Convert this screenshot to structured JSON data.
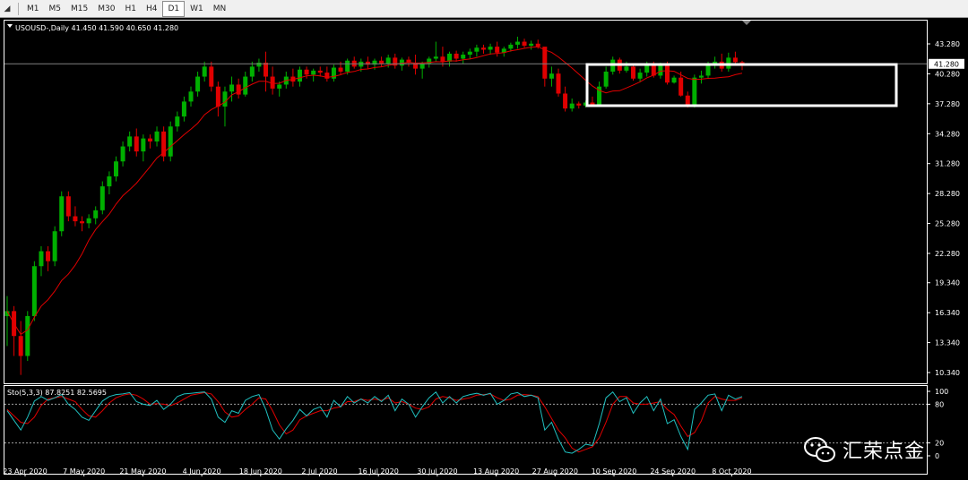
{
  "toolbar": {
    "timeframes": [
      "M1",
      "M5",
      "M15",
      "M30",
      "H1",
      "H4",
      "D1",
      "W1",
      "MN"
    ],
    "active": "D1"
  },
  "chart_data": {
    "type": "candlestick",
    "symbol_header": "USOUSD-,Daily  41.450 41.590 40.650 41.280",
    "price_axis": [
      "43.280",
      "40.280",
      "37.280",
      "34.280",
      "31.280",
      "28.280",
      "25.280",
      "22.280",
      "19.340",
      "16.340",
      "13.340",
      "10.340"
    ],
    "current_price_label": "41.280",
    "current_price": 41.28,
    "x_labels": [
      "23 Apr 2020",
      "7 May 2020",
      "21 May 2020",
      "4 Jun 2020",
      "18 Jun 2020",
      "2 Jul 2020",
      "16 Jul 2020",
      "30 Jul 2020",
      "13 Aug 2020",
      "27 Aug 2020",
      "10 Sep 2020",
      "24 Sep 2020",
      "8 Oct 2020"
    ],
    "bull_color": "#00b000",
    "bear_color": "#e00000",
    "ma_color": "#e00000",
    "candles": [
      [
        16.0,
        18.0,
        13.0,
        16.5
      ],
      [
        16.5,
        17.0,
        12.0,
        14.0
      ],
      [
        14.0,
        15.5,
        10.1,
        12.0
      ],
      [
        12.0,
        16.5,
        11.5,
        16.0
      ],
      [
        16.0,
        21.5,
        15.5,
        21.0
      ],
      [
        21.0,
        23.0,
        20.0,
        22.5
      ],
      [
        22.5,
        23.0,
        20.5,
        21.5
      ],
      [
        21.5,
        25.0,
        21.0,
        24.5
      ],
      [
        24.5,
        28.5,
        24.0,
        28.0
      ],
      [
        28.0,
        28.5,
        25.5,
        26.0
      ],
      [
        26.0,
        27.0,
        25.0,
        25.5
      ],
      [
        25.5,
        26.0,
        24.5,
        25.3
      ],
      [
        25.3,
        26.2,
        24.8,
        25.8
      ],
      [
        25.8,
        27.0,
        25.2,
        26.6
      ],
      [
        26.6,
        29.5,
        26.2,
        29.0
      ],
      [
        29.0,
        30.5,
        28.2,
        30.0
      ],
      [
        30.0,
        32.0,
        29.5,
        31.5
      ],
      [
        31.5,
        33.5,
        31.0,
        33.0
      ],
      [
        33.0,
        34.5,
        32.5,
        34.0
      ],
      [
        34.0,
        34.8,
        32.0,
        32.5
      ],
      [
        32.5,
        34.2,
        31.5,
        33.8
      ],
      [
        33.8,
        34.2,
        32.8,
        33.5
      ],
      [
        33.5,
        35.0,
        33.0,
        34.5
      ],
      [
        34.5,
        35.0,
        31.5,
        32.0
      ],
      [
        32.0,
        35.5,
        31.5,
        35.0
      ],
      [
        35.0,
        36.5,
        34.5,
        36.0
      ],
      [
        36.0,
        38.0,
        35.5,
        37.5
      ],
      [
        37.5,
        39.0,
        37.0,
        38.5
      ],
      [
        38.5,
        40.5,
        38.0,
        40.0
      ],
      [
        40.0,
        41.5,
        39.5,
        41.0
      ],
      [
        41.0,
        41.5,
        38.5,
        39.0
      ],
      [
        39.0,
        39.5,
        36.0,
        37.0
      ],
      [
        37.0,
        39.0,
        35.0,
        38.5
      ],
      [
        38.5,
        40.0,
        37.5,
        39.2
      ],
      [
        39.2,
        39.8,
        37.8,
        38.2
      ],
      [
        38.2,
        40.5,
        38.0,
        40.0
      ],
      [
        40.0,
        41.5,
        39.5,
        41.0
      ],
      [
        41.0,
        41.8,
        40.5,
        41.4
      ],
      [
        41.4,
        42.5,
        38.5,
        40.0
      ],
      [
        40.0,
        41.0,
        38.2,
        38.8
      ],
      [
        38.8,
        39.5,
        38.0,
        39.2
      ],
      [
        39.2,
        40.5,
        38.8,
        40.0
      ],
      [
        40.0,
        40.8,
        39.0,
        39.5
      ],
      [
        39.5,
        41.0,
        39.0,
        40.7
      ],
      [
        40.7,
        41.0,
        39.8,
        40.2
      ],
      [
        40.2,
        40.8,
        39.5,
        40.6
      ],
      [
        40.6,
        41.0,
        40.0,
        40.4
      ],
      [
        40.4,
        41.0,
        39.5,
        39.8
      ],
      [
        39.8,
        41.2,
        39.5,
        40.9
      ],
      [
        40.9,
        41.5,
        40.2,
        40.5
      ],
      [
        40.5,
        41.8,
        40.2,
        41.6
      ],
      [
        41.6,
        42.0,
        40.8,
        41.0
      ],
      [
        41.0,
        41.8,
        40.5,
        41.5
      ],
      [
        41.5,
        42.0,
        40.8,
        41.2
      ],
      [
        41.2,
        41.8,
        40.7,
        41.6
      ],
      [
        41.6,
        42.0,
        41.0,
        41.3
      ],
      [
        41.3,
        42.2,
        40.9,
        41.9
      ],
      [
        41.9,
        42.3,
        40.8,
        41.1
      ],
      [
        41.1,
        41.9,
        40.6,
        41.7
      ],
      [
        41.7,
        42.0,
        41.0,
        41.4
      ],
      [
        41.4,
        42.2,
        40.2,
        40.8
      ],
      [
        40.8,
        41.5,
        39.8,
        41.3
      ],
      [
        41.3,
        42.0,
        40.9,
        41.8
      ],
      [
        41.8,
        43.5,
        41.5,
        42.0
      ],
      [
        42.0,
        43.0,
        41.0,
        41.5
      ],
      [
        41.5,
        42.5,
        41.0,
        42.3
      ],
      [
        42.3,
        42.6,
        41.5,
        41.8
      ],
      [
        41.8,
        42.5,
        41.3,
        42.2
      ],
      [
        42.2,
        42.8,
        41.8,
        42.5
      ],
      [
        42.5,
        43.2,
        42.0,
        42.9
      ],
      [
        42.9,
        43.2,
        42.3,
        42.7
      ],
      [
        42.7,
        43.3,
        42.2,
        43.0
      ],
      [
        43.0,
        43.5,
        42.0,
        42.4
      ],
      [
        42.4,
        43.0,
        42.0,
        42.8
      ],
      [
        42.8,
        43.4,
        42.5,
        43.2
      ],
      [
        43.2,
        44.0,
        42.8,
        43.5
      ],
      [
        43.5,
        43.8,
        42.9,
        43.1
      ],
      [
        43.1,
        43.6,
        42.7,
        43.3
      ],
      [
        43.3,
        43.7,
        42.8,
        43.0
      ],
      [
        43.0,
        42.5,
        39.0,
        39.8
      ],
      [
        39.8,
        41.0,
        39.0,
        40.3
      ],
      [
        40.3,
        40.8,
        38.0,
        38.3
      ],
      [
        38.3,
        39.0,
        36.5,
        36.8
      ],
      [
        36.8,
        37.8,
        36.5,
        37.3
      ],
      [
        37.3,
        37.5,
        36.8,
        37.1
      ],
      [
        37.1,
        37.6,
        36.9,
        37.4
      ],
      [
        37.4,
        38.0,
        37.0,
        37.2
      ],
      [
        37.2,
        39.5,
        37.0,
        39.0
      ],
      [
        39.0,
        41.0,
        38.8,
        40.5
      ],
      [
        40.5,
        42.0,
        40.2,
        41.7
      ],
      [
        41.7,
        41.9,
        40.3,
        40.6
      ],
      [
        40.6,
        41.5,
        40.4,
        41.0
      ],
      [
        41.0,
        41.3,
        39.6,
        39.8
      ],
      [
        39.8,
        40.8,
        39.5,
        40.4
      ],
      [
        40.4,
        41.5,
        40.0,
        41.2
      ],
      [
        41.2,
        41.5,
        39.9,
        40.1
      ],
      [
        40.1,
        41.4,
        39.8,
        41.2
      ],
      [
        41.2,
        41.5,
        39.2,
        39.4
      ],
      [
        39.4,
        40.1,
        39.3,
        39.9
      ],
      [
        39.9,
        40.5,
        38.0,
        38.1
      ],
      [
        38.1,
        38.5,
        36.9,
        37.1
      ],
      [
        37.1,
        40.2,
        36.9,
        39.9
      ],
      [
        39.9,
        40.6,
        39.3,
        40.1
      ],
      [
        40.1,
        41.5,
        39.8,
        41.2
      ],
      [
        41.2,
        42.0,
        40.8,
        41.5
      ],
      [
        41.5,
        42.3,
        40.5,
        40.8
      ],
      [
        40.8,
        42.4,
        40.5,
        41.9
      ],
      [
        41.9,
        42.5,
        41.2,
        41.45
      ],
      [
        41.45,
        41.59,
        40.65,
        41.28
      ]
    ],
    "indicator": {
      "label": "Sto(5,3,3) 87.8251 82.5695",
      "levels": [
        "100",
        "80",
        "20",
        "0"
      ],
      "main_color": "#20c0c0",
      "signal_color": "#e00000",
      "main": [
        70,
        55,
        40,
        60,
        85,
        92,
        86,
        90,
        95,
        80,
        72,
        60,
        55,
        70,
        85,
        92,
        95,
        96,
        98,
        84,
        80,
        78,
        86,
        72,
        80,
        92,
        96,
        97,
        98,
        99,
        88,
        60,
        52,
        70,
        66,
        86,
        92,
        95,
        72,
        40,
        26,
        42,
        55,
        72,
        62,
        72,
        76,
        60,
        86,
        76,
        92,
        82,
        88,
        82,
        92,
        84,
        94,
        70,
        88,
        80,
        60,
        76,
        90,
        99,
        82,
        92,
        82,
        92,
        95,
        97,
        94,
        97,
        80,
        86,
        96,
        98,
        92,
        94,
        90,
        40,
        52,
        26,
        6,
        4,
        10,
        18,
        16,
        50,
        90,
        99,
        84,
        90,
        66,
        82,
        92,
        70,
        88,
        50,
        56,
        30,
        10,
        72,
        82,
        94,
        96,
        70,
        94,
        88,
        92
      ],
      "signal": [
        72,
        62,
        52,
        50,
        60,
        78,
        88,
        90,
        92,
        88,
        84,
        72,
        62,
        60,
        70,
        82,
        90,
        94,
        96,
        94,
        88,
        80,
        81,
        80,
        78,
        82,
        88,
        94,
        96,
        98,
        96,
        84,
        68,
        60,
        62,
        72,
        80,
        90,
        88,
        70,
        48,
        34,
        40,
        56,
        62,
        66,
        70,
        70,
        74,
        76,
        84,
        84,
        88,
        86,
        88,
        86,
        90,
        82,
        84,
        80,
        74,
        72,
        76,
        88,
        92,
        90,
        86,
        88,
        90,
        94,
        95,
        96,
        90,
        86,
        88,
        94,
        95,
        94,
        92,
        76,
        58,
        40,
        28,
        12,
        6,
        10,
        14,
        28,
        52,
        80,
        92,
        92,
        82,
        80,
        80,
        82,
        84,
        72,
        64,
        46,
        30,
        36,
        54,
        82,
        92,
        88,
        86,
        86,
        90
      ]
    }
  },
  "watermark": {
    "text": "汇荣点金"
  }
}
